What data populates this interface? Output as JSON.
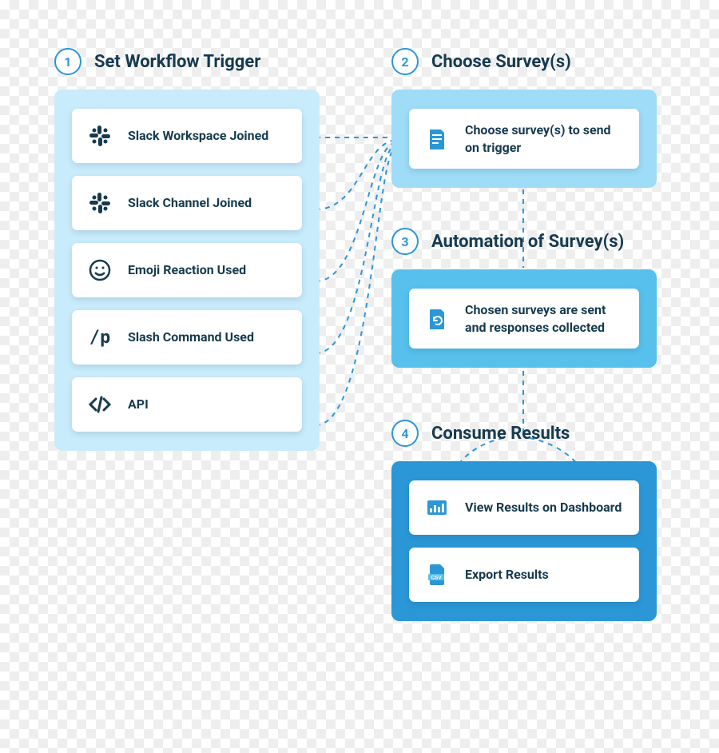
{
  "steps": [
    {
      "num": "1",
      "title": "Set Workflow Trigger"
    },
    {
      "num": "2",
      "title": "Choose Survey(s)"
    },
    {
      "num": "3",
      "title": "Automation of Survey(s)"
    },
    {
      "num": "4",
      "title": "Consume Results"
    }
  ],
  "panel1": {
    "items": [
      {
        "label": "Slack Workspace Joined"
      },
      {
        "label": "Slack Channel Joined"
      },
      {
        "label": "Emoji Reaction Used"
      },
      {
        "label": "Slash Command Used"
      },
      {
        "label": "API"
      }
    ]
  },
  "panel2": {
    "items": [
      {
        "label": "Choose survey(s) to send on trigger"
      }
    ]
  },
  "panel3": {
    "items": [
      {
        "label": "Chosen surveys are sent and responses collected"
      }
    ]
  },
  "panel4": {
    "items": [
      {
        "label": "View Results on Dashboard"
      },
      {
        "label": "Export Results"
      }
    ]
  }
}
